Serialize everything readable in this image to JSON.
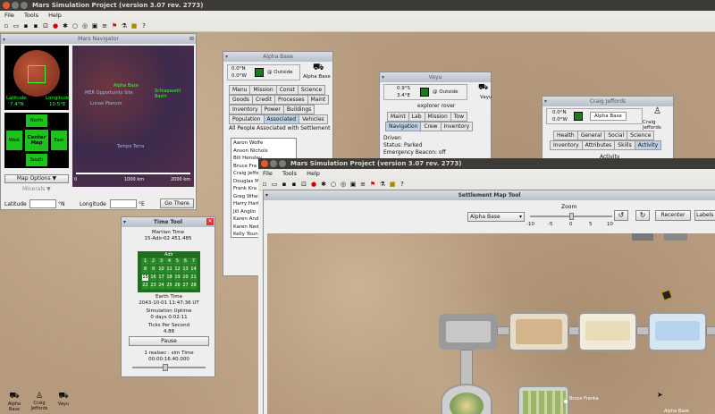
{
  "app": {
    "title": "Mars Simulation Project (version 3.07 rev. 2773)",
    "menu": [
      "File",
      "Tools",
      "Help"
    ]
  },
  "navigator": {
    "title": "Mars Navigator",
    "latitude_label": "Latitude",
    "latitude_value": "7.4°N",
    "longitude_label": "Longitude",
    "longitude_value": "10.5°E",
    "compass": [
      "North",
      "South",
      "West",
      "East"
    ],
    "center_label": "Center Map",
    "map_options": "Map Options ▼",
    "minerals": "Minerals ▼",
    "scale_labels": [
      "0",
      "1000 km",
      "2000 km"
    ],
    "lat_field_label": "Latitude",
    "lat_unit": "°N",
    "lon_field_label": "Longitude",
    "lon_unit": "°E",
    "go_there": "Go There",
    "map_labels": [
      "MER Opportunity Site",
      "Alpha Base",
      "Lunae Planum",
      "Schiaparelli Basin",
      "Tempe Terra"
    ]
  },
  "alpha_base": {
    "title": "Alpha Base",
    "coords": [
      "0.0°N",
      "0.0°W"
    ],
    "location": "@ Outside",
    "name": "Alpha Base",
    "tabs_row1": [
      "Manu",
      "Mission",
      "Const",
      "Science"
    ],
    "tabs_row2": [
      "Goods",
      "Credit",
      "Processes",
      "Maint"
    ],
    "tabs_row3": [
      "Inventory",
      "Power",
      "Buildings"
    ],
    "tabs_row4": [
      "Population",
      "Associated",
      "Vehicles"
    ],
    "section": "All People Associated with Settlement",
    "people": [
      "Aaron Wolfe",
      "Anson Nichols",
      "Bill Hensley",
      "Bruce Fra",
      "Craig Jeffo",
      "Douglas M",
      "Frank Kra",
      "Greg Whel",
      "Harry Hart",
      "Jill Anglin",
      "Karen And",
      "Karen Ned",
      "Kelly Youn"
    ]
  },
  "vayu": {
    "title": "Vayu",
    "coords": [
      "0.9°S",
      "3.4°E"
    ],
    "location": "@ Outside",
    "type": "explorer rover",
    "name": "Vayu",
    "tabs_row1": [
      "Maint",
      "Lab",
      "Mission",
      "Tow"
    ],
    "tabs_row2": [
      "Navigation",
      "Crew",
      "Inventory"
    ],
    "status_lines": [
      "Driven",
      "Status: Parked",
      "Emergency Beacon: off"
    ]
  },
  "craig": {
    "title": "Craig Jeffords",
    "coords": [
      "0.0°N",
      "0.0°W"
    ],
    "location": "Alpha Base",
    "name": "Craig Jeffords",
    "tabs_row1": [
      "Health",
      "General",
      "Social",
      "Science"
    ],
    "tabs_row2": [
      "Inventory",
      "Attributes",
      "Skills",
      "Activity"
    ],
    "section": "Activity"
  },
  "time_tool": {
    "title": "Time Tool",
    "martian_time_label": "Martian Time",
    "martian_time": "15-Adir-02  451.485",
    "month": "Adir",
    "days": [
      "1",
      "2",
      "3",
      "4",
      "5",
      "6",
      "7",
      "8",
      "9",
      "10",
      "11",
      "12",
      "13",
      "14",
      "15",
      "16",
      "17",
      "18",
      "19",
      "20",
      "21",
      "22",
      "23",
      "24",
      "25",
      "26",
      "27",
      "28"
    ],
    "current_day": "15",
    "earth_time_label": "Earth Time",
    "earth_time": "2043-10-01  11:47:36 UT",
    "uptime_label": "Simulation Uptime",
    "uptime": "0 days 0:02:11",
    "tps_label": "Ticks Per Second",
    "tps": "4.88",
    "pause": "Pause",
    "ratio_label": "1 realsec : sim Time",
    "ratio": "00:00:16.40.000"
  },
  "settlement_map": {
    "title": "Settlement Map Tool",
    "settlement": "Alpha Base",
    "zoom_label": "Zoom",
    "zoom_ticks": [
      "-10",
      "-5",
      "0",
      "5",
      "10"
    ],
    "zoom_value": 0,
    "recenter": "Recenter",
    "labels": "Labels ▼",
    "person_label": "Bruce Franka",
    "building_label": "Alpha Base"
  },
  "desktop_icons": [
    "Alpha Base",
    "Craig Jeffords",
    "Vayu"
  ]
}
